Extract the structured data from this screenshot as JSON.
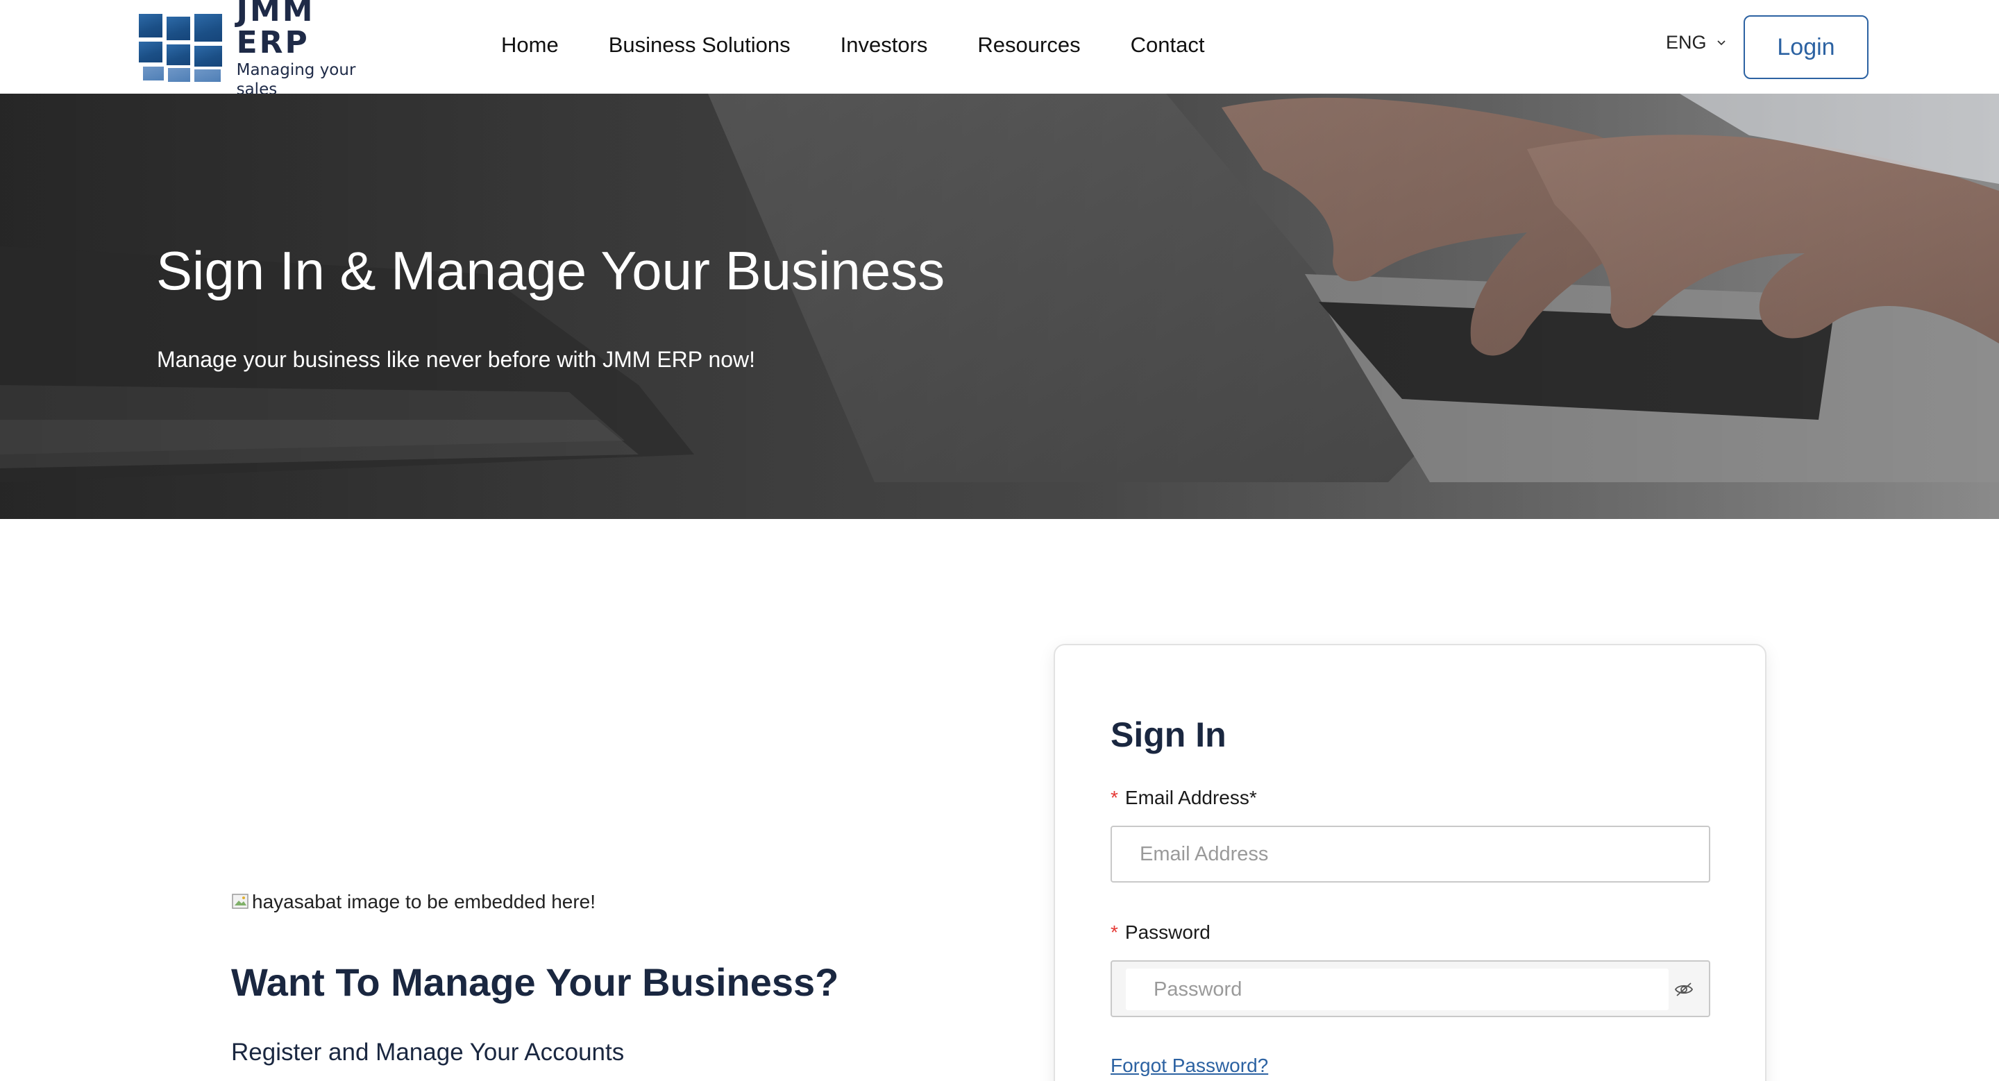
{
  "header": {
    "logo_title": "JMM ERP",
    "logo_subtitle": "Managing your sales",
    "nav": [
      "Home",
      "Business Solutions",
      "Investors",
      "Resources",
      "Contact"
    ],
    "language": "ENG",
    "login_label": "Login"
  },
  "hero": {
    "title": "Sign In & Manage Your Business",
    "subtitle": "Manage your business like never before with JMM ERP now!"
  },
  "promo": {
    "image_alt": "hayasabat image to be embedded here!",
    "title_regular": "Want To Manage Your ",
    "title_bold": "Business?",
    "subtitle": "Register and Manage Your Accounts"
  },
  "signin": {
    "title": "Sign In",
    "required_mark": "*",
    "email_label": "Email Address*",
    "email_placeholder": "Email Address",
    "password_label": "Password",
    "password_placeholder": "Password",
    "forgot_label": "Forgot Password?"
  },
  "colors": {
    "brand_blue": "#2c62a2",
    "heading_navy": "#1a2740",
    "required_red": "#e53935"
  },
  "icons": [
    "logo-mark-icon",
    "chevron-down-icon",
    "broken-image-icon",
    "eye-off-icon"
  ]
}
